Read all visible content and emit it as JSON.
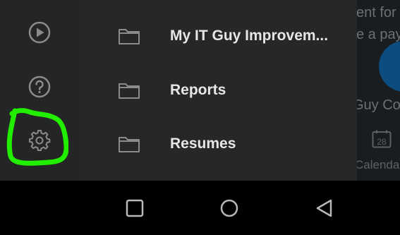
{
  "background_app": {
    "line1": "ent for",
    "line2": "e a pay",
    "line3": "Guy Co",
    "calendar_day": "28",
    "calendar_label": "Calendar"
  },
  "rail": {
    "items": [
      {
        "icon": "play-circle-icon"
      },
      {
        "icon": "help-circle-icon"
      },
      {
        "icon": "gear-icon",
        "highlighted": true
      }
    ],
    "highlight_color": "#22ee00"
  },
  "drawer": {
    "folders": [
      {
        "label": "My IT Guy Improvem..."
      },
      {
        "label": "Reports"
      },
      {
        "label": "Resumes"
      }
    ]
  },
  "system_nav": {
    "buttons": [
      "recent-apps",
      "home",
      "back"
    ]
  },
  "colors": {
    "rail_bg": "#242625",
    "drawer_bg": "#262826",
    "icon": "#8a8c8b",
    "text": "#e6e6e6"
  }
}
